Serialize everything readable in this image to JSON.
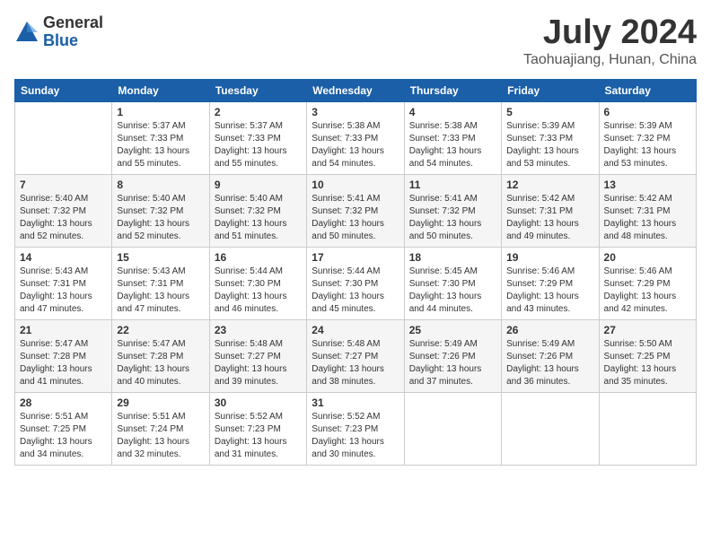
{
  "header": {
    "logo_general": "General",
    "logo_blue": "Blue",
    "month_year": "July 2024",
    "location": "Taohuajiang, Hunan, China"
  },
  "days_of_week": [
    "Sunday",
    "Monday",
    "Tuesday",
    "Wednesday",
    "Thursday",
    "Friday",
    "Saturday"
  ],
  "weeks": [
    [
      {
        "day": "",
        "info": ""
      },
      {
        "day": "1",
        "info": "Sunrise: 5:37 AM\nSunset: 7:33 PM\nDaylight: 13 hours\nand 55 minutes."
      },
      {
        "day": "2",
        "info": "Sunrise: 5:37 AM\nSunset: 7:33 PM\nDaylight: 13 hours\nand 55 minutes."
      },
      {
        "day": "3",
        "info": "Sunrise: 5:38 AM\nSunset: 7:33 PM\nDaylight: 13 hours\nand 54 minutes."
      },
      {
        "day": "4",
        "info": "Sunrise: 5:38 AM\nSunset: 7:33 PM\nDaylight: 13 hours\nand 54 minutes."
      },
      {
        "day": "5",
        "info": "Sunrise: 5:39 AM\nSunset: 7:33 PM\nDaylight: 13 hours\nand 53 minutes."
      },
      {
        "day": "6",
        "info": "Sunrise: 5:39 AM\nSunset: 7:32 PM\nDaylight: 13 hours\nand 53 minutes."
      }
    ],
    [
      {
        "day": "7",
        "info": "Sunrise: 5:40 AM\nSunset: 7:32 PM\nDaylight: 13 hours\nand 52 minutes."
      },
      {
        "day": "8",
        "info": "Sunrise: 5:40 AM\nSunset: 7:32 PM\nDaylight: 13 hours\nand 52 minutes."
      },
      {
        "day": "9",
        "info": "Sunrise: 5:40 AM\nSunset: 7:32 PM\nDaylight: 13 hours\nand 51 minutes."
      },
      {
        "day": "10",
        "info": "Sunrise: 5:41 AM\nSunset: 7:32 PM\nDaylight: 13 hours\nand 50 minutes."
      },
      {
        "day": "11",
        "info": "Sunrise: 5:41 AM\nSunset: 7:32 PM\nDaylight: 13 hours\nand 50 minutes."
      },
      {
        "day": "12",
        "info": "Sunrise: 5:42 AM\nSunset: 7:31 PM\nDaylight: 13 hours\nand 49 minutes."
      },
      {
        "day": "13",
        "info": "Sunrise: 5:42 AM\nSunset: 7:31 PM\nDaylight: 13 hours\nand 48 minutes."
      }
    ],
    [
      {
        "day": "14",
        "info": "Sunrise: 5:43 AM\nSunset: 7:31 PM\nDaylight: 13 hours\nand 47 minutes."
      },
      {
        "day": "15",
        "info": "Sunrise: 5:43 AM\nSunset: 7:31 PM\nDaylight: 13 hours\nand 47 minutes."
      },
      {
        "day": "16",
        "info": "Sunrise: 5:44 AM\nSunset: 7:30 PM\nDaylight: 13 hours\nand 46 minutes."
      },
      {
        "day": "17",
        "info": "Sunrise: 5:44 AM\nSunset: 7:30 PM\nDaylight: 13 hours\nand 45 minutes."
      },
      {
        "day": "18",
        "info": "Sunrise: 5:45 AM\nSunset: 7:30 PM\nDaylight: 13 hours\nand 44 minutes."
      },
      {
        "day": "19",
        "info": "Sunrise: 5:46 AM\nSunset: 7:29 PM\nDaylight: 13 hours\nand 43 minutes."
      },
      {
        "day": "20",
        "info": "Sunrise: 5:46 AM\nSunset: 7:29 PM\nDaylight: 13 hours\nand 42 minutes."
      }
    ],
    [
      {
        "day": "21",
        "info": "Sunrise: 5:47 AM\nSunset: 7:28 PM\nDaylight: 13 hours\nand 41 minutes."
      },
      {
        "day": "22",
        "info": "Sunrise: 5:47 AM\nSunset: 7:28 PM\nDaylight: 13 hours\nand 40 minutes."
      },
      {
        "day": "23",
        "info": "Sunrise: 5:48 AM\nSunset: 7:27 PM\nDaylight: 13 hours\nand 39 minutes."
      },
      {
        "day": "24",
        "info": "Sunrise: 5:48 AM\nSunset: 7:27 PM\nDaylight: 13 hours\nand 38 minutes."
      },
      {
        "day": "25",
        "info": "Sunrise: 5:49 AM\nSunset: 7:26 PM\nDaylight: 13 hours\nand 37 minutes."
      },
      {
        "day": "26",
        "info": "Sunrise: 5:49 AM\nSunset: 7:26 PM\nDaylight: 13 hours\nand 36 minutes."
      },
      {
        "day": "27",
        "info": "Sunrise: 5:50 AM\nSunset: 7:25 PM\nDaylight: 13 hours\nand 35 minutes."
      }
    ],
    [
      {
        "day": "28",
        "info": "Sunrise: 5:51 AM\nSunset: 7:25 PM\nDaylight: 13 hours\nand 34 minutes."
      },
      {
        "day": "29",
        "info": "Sunrise: 5:51 AM\nSunset: 7:24 PM\nDaylight: 13 hours\nand 32 minutes."
      },
      {
        "day": "30",
        "info": "Sunrise: 5:52 AM\nSunset: 7:23 PM\nDaylight: 13 hours\nand 31 minutes."
      },
      {
        "day": "31",
        "info": "Sunrise: 5:52 AM\nSunset: 7:23 PM\nDaylight: 13 hours\nand 30 minutes."
      },
      {
        "day": "",
        "info": ""
      },
      {
        "day": "",
        "info": ""
      },
      {
        "day": "",
        "info": ""
      }
    ]
  ]
}
